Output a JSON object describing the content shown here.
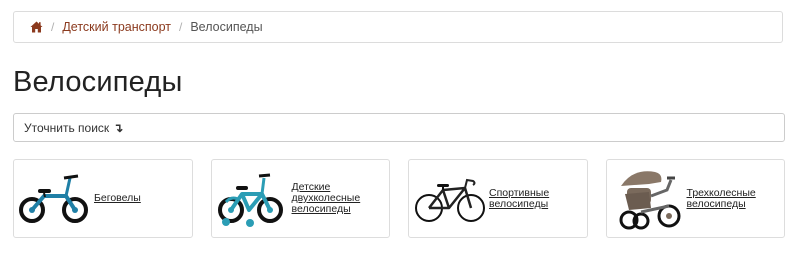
{
  "breadcrumb": {
    "home_icon": "home-icon",
    "separator": "/",
    "items": [
      {
        "label": "Детский транспорт"
      },
      {
        "label": "Велосипеды"
      }
    ]
  },
  "page_title": "Велосипеды",
  "refine_search": {
    "label": "Уточнить поиск",
    "arrow": "↴"
  },
  "categories": [
    {
      "label": "Беговелы",
      "image": "balance-bike-image",
      "color": "#1f7fa6"
    },
    {
      "label": "Детские двухколесные велосипеды",
      "image": "kids-bike-image",
      "color": "#2b9db5"
    },
    {
      "label": "Спортивные велосипеды",
      "image": "road-bike-image",
      "color": "#1a1a1a"
    },
    {
      "label": "Трехколесные велосипеды",
      "image": "tricycle-image",
      "color": "#7a6a5c"
    }
  ],
  "colors": {
    "link": "#8b3a1e",
    "border": "#dddddd",
    "title": "#222222"
  }
}
